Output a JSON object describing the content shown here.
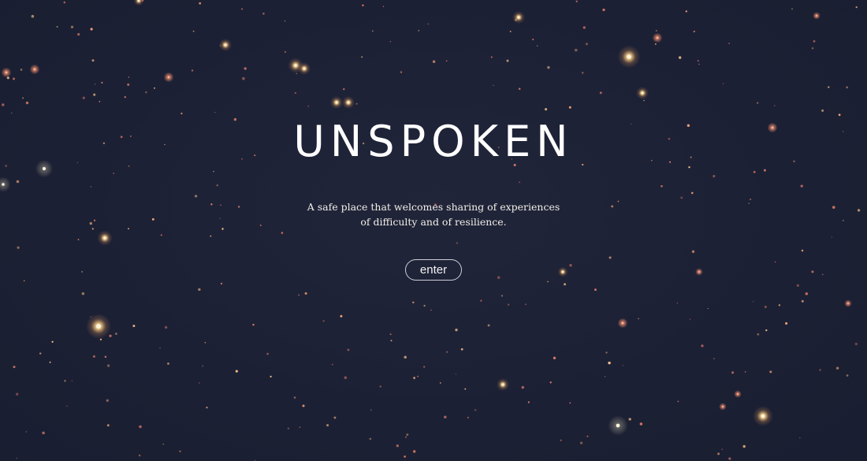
{
  "page": {
    "title": "UNSPOKEN",
    "tagline": [
      "A safe place that welcomes sharing of experiences",
      "of difficulty and of resilience."
    ],
    "enter_label": "enter"
  },
  "theme": {
    "background": "#1d2135",
    "star_warm": "#f3a27a",
    "star_glow": "#f6d28a"
  }
}
